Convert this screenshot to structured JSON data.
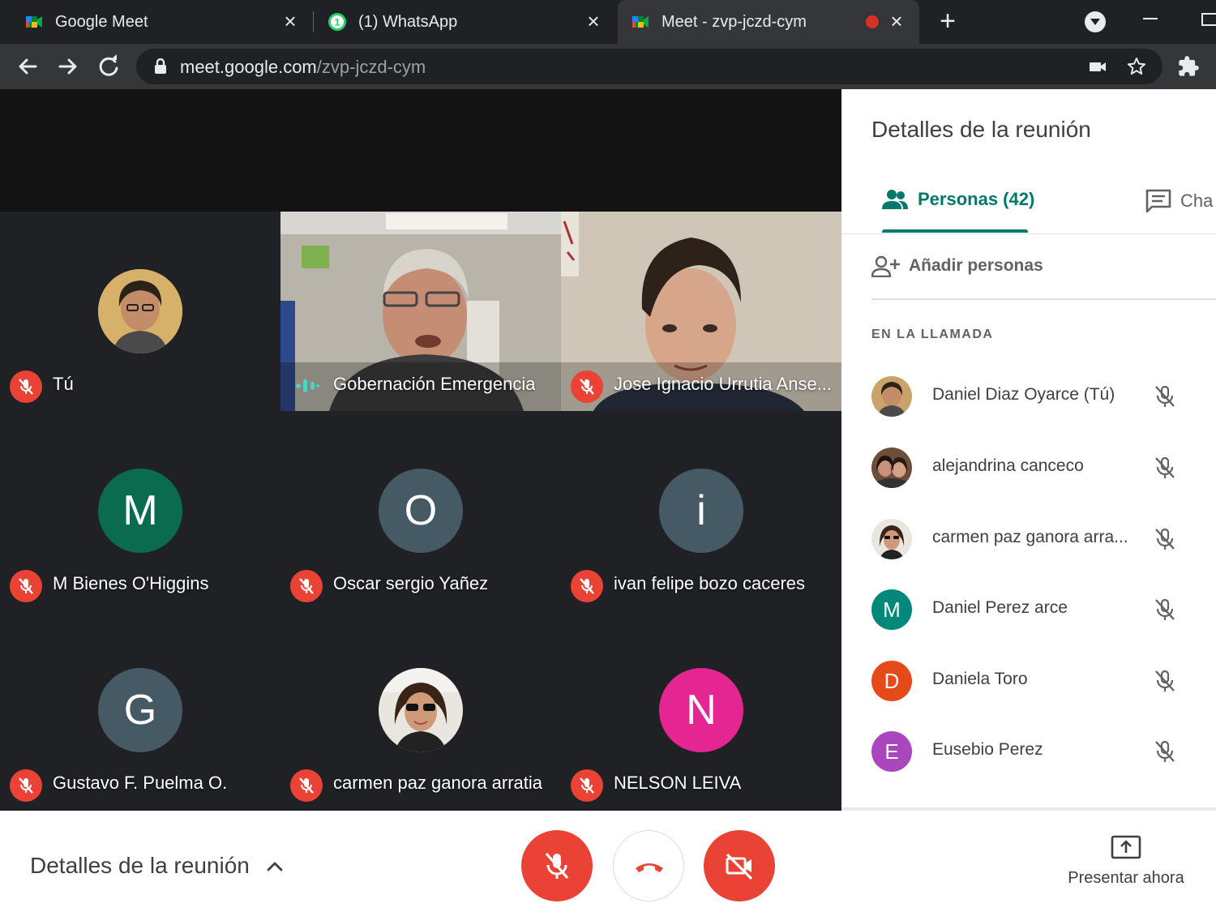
{
  "browser": {
    "tabs": [
      {
        "title": "Google Meet",
        "icon": "meet-icon"
      },
      {
        "title": "(1) WhatsApp",
        "icon": "whatsapp-icon"
      },
      {
        "title": "Meet - zvp-jczd-cym",
        "icon": "meet-icon",
        "recording": true
      }
    ],
    "url_host": "meet.google.com",
    "url_path": "/zvp-jczd-cym"
  },
  "tiles": [
    {
      "name": "Tú",
      "muted": true,
      "avatar_type": "photo"
    },
    {
      "name": "Gobernación Emergencia",
      "muted": false,
      "speaking": true,
      "avatar_type": "video"
    },
    {
      "name": "Jose Ignacio Urrutia Anse...",
      "muted": true,
      "avatar_type": "video"
    },
    {
      "name": "M Bienes O'Higgins",
      "muted": true,
      "initial": "M",
      "color": "#0b6b4f"
    },
    {
      "name": "Oscar sergio Yañez",
      "muted": true,
      "initial": "O",
      "color": "#455a64"
    },
    {
      "name": "ivan felipe bozo caceres",
      "muted": true,
      "initial": "i",
      "color": "#455a64"
    },
    {
      "name": "Gustavo F. Puelma O.",
      "muted": true,
      "initial": "G",
      "color": "#455a64"
    },
    {
      "name": "carmen paz ganora arratia",
      "muted": true,
      "avatar_type": "photo"
    },
    {
      "name": "NELSON LEIVA",
      "muted": true,
      "initial": "N",
      "color": "#e52592"
    }
  ],
  "panel": {
    "title": "Detalles de la reunión",
    "people_tab": "Personas (42)",
    "chat_tab": "Cha",
    "add_people": "Añadir personas",
    "section": "EN LA LLAMADA",
    "people": [
      {
        "name": "Daniel Diaz Oyarce (Tú)",
        "avatar_type": "photo",
        "color": "#8d6e63"
      },
      {
        "name": "alejandrina canceco",
        "avatar_type": "photo",
        "color": "#5d4037"
      },
      {
        "name": "carmen paz ganora arra...",
        "avatar_type": "photo",
        "color": "#a1887f"
      },
      {
        "name": "Daniel Perez arce",
        "initial": "M",
        "color": "#00897b"
      },
      {
        "name": "Daniela Toro",
        "initial": "D",
        "color": "#e64a19"
      },
      {
        "name": "Eusebio Perez",
        "initial": "E",
        "color": "#ab47bc"
      }
    ]
  },
  "bottom": {
    "details_label": "Detalles de la reunión",
    "present_label": "Presentar ahora"
  },
  "colors": {
    "accent": "#00796b",
    "danger": "#ea4335",
    "dark_bg": "#202124"
  }
}
